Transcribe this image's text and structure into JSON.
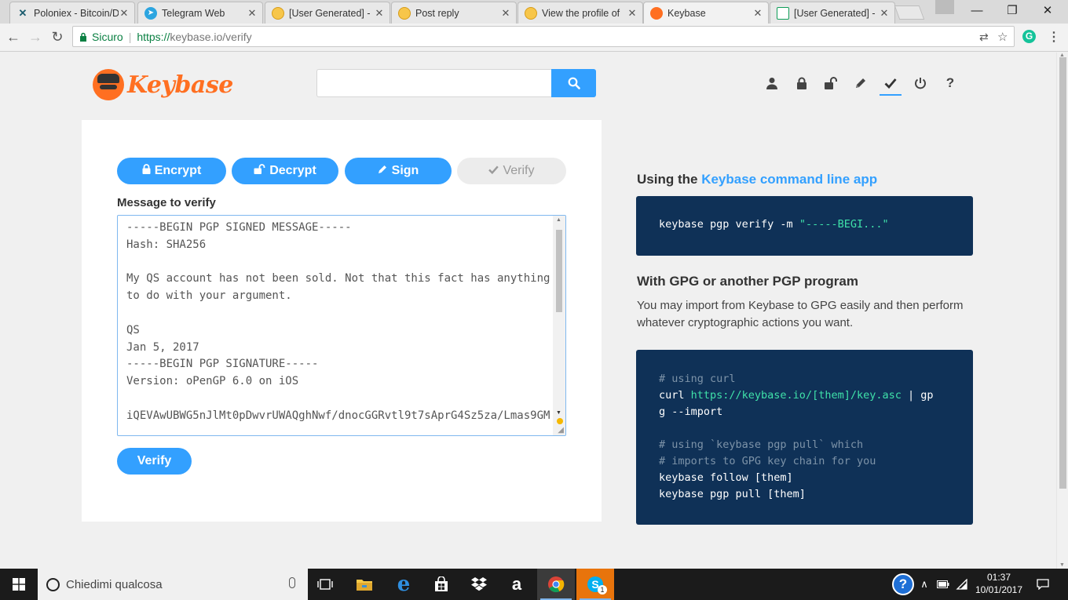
{
  "browser": {
    "tabs": [
      {
        "title": "Poloniex - Bitcoin/D",
        "icon": "poloniex-icon",
        "active": false
      },
      {
        "title": "Telegram Web",
        "icon": "telegram-icon",
        "active": false
      },
      {
        "title": "[User Generated] -",
        "icon": "coin-icon",
        "active": false
      },
      {
        "title": "Post reply",
        "icon": "coin-icon",
        "active": false
      },
      {
        "title": "View the profile of",
        "icon": "coin-icon",
        "active": false
      },
      {
        "title": "Keybase",
        "icon": "keybase-icon",
        "active": true
      },
      {
        "title": "[User Generated] -",
        "icon": "sheet-icon",
        "active": false
      }
    ],
    "tab_close": "✕",
    "address": {
      "secure_label": "Sicuro",
      "scheme": "https://",
      "host_path": "keybase.io/verify"
    },
    "window_controls": {
      "minimize": "—",
      "restore": "❐",
      "close": "✕"
    },
    "extension_letter": "G",
    "menu_glyph": "⋮"
  },
  "keybase": {
    "brand": "Keybase",
    "search_value": "",
    "nav_icons": [
      "user-icon",
      "lock-icon",
      "unlock-icon",
      "pencil-icon",
      "check-icon",
      "power-icon",
      "help-icon"
    ],
    "help_glyph": "?",
    "modes": [
      {
        "label": "Encrypt",
        "glyph": "🔒︎",
        "enabled": true
      },
      {
        "label": "Decrypt",
        "glyph": "🔓︎",
        "enabled": true
      },
      {
        "label": "Sign",
        "glyph": "✎",
        "enabled": true
      },
      {
        "label": "Verify",
        "glyph": "✔",
        "enabled": false
      }
    ],
    "message_label": "Message to verify",
    "message_value": "-----BEGIN PGP SIGNED MESSAGE-----\nHash: SHA256\n\nMy QS account has not been sold. Not that this fact has anything to do with your argument.\n\nQS\nJan 5, 2017\n-----BEGIN PGP SIGNATURE-----\nVersion: oPenGP 6.0 on iOS\n\niQEVAwUBWG5nJlMt0pDwvrUWAQghNwf/dnocGGRvtl9t7sAprG4Sz5za/Lmas9GM",
    "verify_button": "Verify",
    "cli": {
      "heading_prefix": "Using the",
      "heading_link": "Keybase command line app",
      "command": "keybase pgp verify -m ",
      "command_arg": "\"-----BEGI...\""
    },
    "gpg": {
      "heading": "With GPG or another PGP program",
      "paragraph": "You may import from Keybase to GPG easily and then perform whatever cryptographic actions you want.",
      "lines": [
        {
          "text": "# using curl",
          "kind": "cmt"
        },
        {
          "text": "curl ",
          "kind": "plain",
          "url": "https://keybase.io/[them]/key.asc",
          "after": " | gp"
        },
        {
          "text": "g --import",
          "kind": "plain"
        },
        {
          "text": "",
          "kind": "plain"
        },
        {
          "text": "# using `keybase pgp pull` which",
          "kind": "cmt"
        },
        {
          "text": "# imports to GPG key chain for you",
          "kind": "cmt"
        },
        {
          "text": "keybase follow [them]",
          "kind": "plain"
        },
        {
          "text": "keybase pgp pull [them]",
          "kind": "plain"
        }
      ]
    }
  },
  "taskbar": {
    "search_placeholder": "Chiedimi qualcosa",
    "apps": [
      "task-view-icon",
      "file-explorer-icon",
      "edge-icon",
      "store-icon",
      "dropbox-icon",
      "amazon-icon",
      "chrome-icon",
      "skype-icon"
    ],
    "skype_badge": "1",
    "time": "01:37",
    "date": "10/01/2017"
  },
  "colors": {
    "accent": "#33a0ff",
    "brand_orange": "#ff6f21",
    "code_bg": "#0f3157",
    "code_string": "#3fe1a9"
  }
}
